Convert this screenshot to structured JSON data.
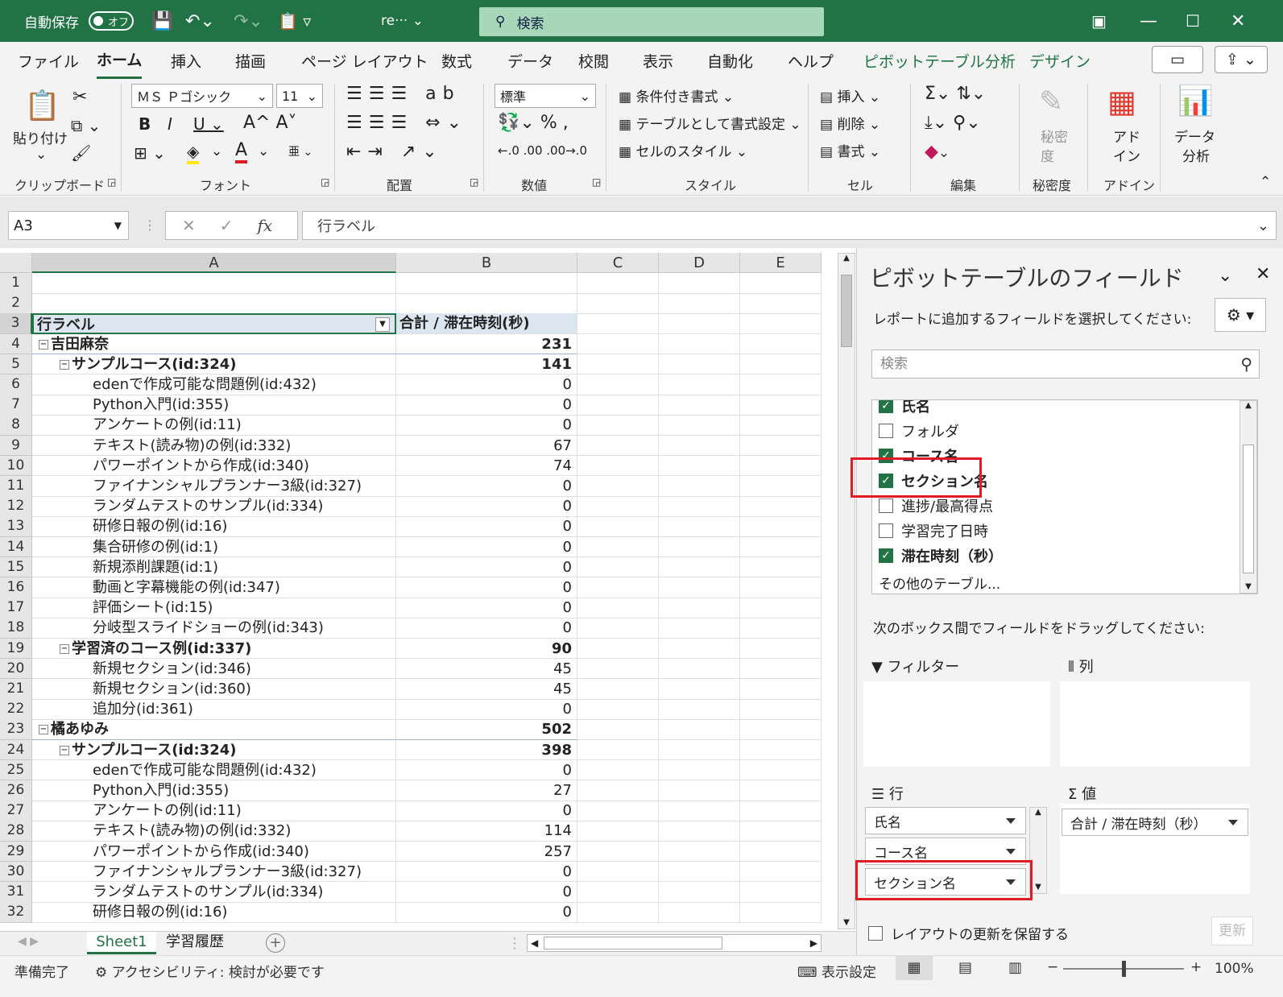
{
  "titlebar": {
    "autosave": "自動保存",
    "autosave_state": "オフ",
    "filename": "re···",
    "search_placeholder": "検索"
  },
  "menu": [
    "ファイル",
    "ホーム",
    "挿入",
    "描画",
    "ページ レイアウト",
    "数式",
    "データ",
    "校閲",
    "表示",
    "自動化",
    "ヘルプ",
    "ピボットテーブル分析",
    "デザイン"
  ],
  "ribbon": {
    "clipboard": {
      "paste": "貼り付け",
      "label": "クリップボード"
    },
    "font": {
      "name": "ＭＳ Ｐゴシック",
      "size": "11",
      "label": "フォント"
    },
    "align": {
      "label": "配置"
    },
    "number": {
      "format": "標準",
      "label": "数値"
    },
    "style": {
      "cond": "条件付き書式",
      "table": "テーブルとして書式設定",
      "cell": "セルのスタイル",
      "label": "スタイル"
    },
    "cells": {
      "insert": "挿入",
      "delete": "削除",
      "format": "書式",
      "label": "セル"
    },
    "edit": {
      "label": "編集"
    },
    "sens": {
      "btn1": "秘密",
      "btn2": "度",
      "label": "秘密度"
    },
    "addin": {
      "btn1": "アド",
      "btn2": "イン",
      "label": "アドイン"
    },
    "analyze": {
      "btn1": "データ",
      "btn2": "分析"
    }
  },
  "formula": {
    "namebox": "A3",
    "fx": "fx",
    "content": "行ラベル"
  },
  "columns": [
    "A",
    "B",
    "C",
    "D",
    "E"
  ],
  "rows": [
    {
      "n": "1",
      "a": "",
      "b": ""
    },
    {
      "n": "2",
      "a": "",
      "b": ""
    },
    {
      "n": "3",
      "a": "行ラベル",
      "b": "合計 / 滞在時刻(秒)"
    },
    {
      "n": "4",
      "a": "吉田麻奈",
      "b": "231"
    },
    {
      "n": "5",
      "a": "サンプルコース(id:324)",
      "b": "141"
    },
    {
      "n": "6",
      "a": "edenで作成可能な問題例(id:432)",
      "b": "0"
    },
    {
      "n": "7",
      "a": "Python入門(id:355)",
      "b": "0"
    },
    {
      "n": "8",
      "a": "アンケートの例(id:11)",
      "b": "0"
    },
    {
      "n": "9",
      "a": "テキスト(読み物)の例(id:332)",
      "b": "67"
    },
    {
      "n": "10",
      "a": "パワーポイントから作成(id:340)",
      "b": "74"
    },
    {
      "n": "11",
      "a": "ファイナンシャルプランナー3級(id:327)",
      "b": "0"
    },
    {
      "n": "12",
      "a": "ランダムテストのサンプル(id:334)",
      "b": "0"
    },
    {
      "n": "13",
      "a": "研修日報の例(id:16)",
      "b": "0"
    },
    {
      "n": "14",
      "a": "集合研修の例(id:1)",
      "b": "0"
    },
    {
      "n": "15",
      "a": "新規添削課題(id:1)",
      "b": "0"
    },
    {
      "n": "16",
      "a": "動画と字幕機能の例(id:347)",
      "b": "0"
    },
    {
      "n": "17",
      "a": "評価シート(id:15)",
      "b": "0"
    },
    {
      "n": "18",
      "a": "分岐型スライドショーの例(id:343)",
      "b": "0"
    },
    {
      "n": "19",
      "a": "学習済のコース例(id:337)",
      "b": "90"
    },
    {
      "n": "20",
      "a": "新規セクション(id:346)",
      "b": "45"
    },
    {
      "n": "21",
      "a": "新規セクション(id:360)",
      "b": "45"
    },
    {
      "n": "22",
      "a": "追加分(id:361)",
      "b": "0"
    },
    {
      "n": "23",
      "a": "橘あゆみ",
      "b": "502"
    },
    {
      "n": "24",
      "a": "サンプルコース(id:324)",
      "b": "398"
    },
    {
      "n": "25",
      "a": "edenで作成可能な問題例(id:432)",
      "b": "0"
    },
    {
      "n": "26",
      "a": "Python入門(id:355)",
      "b": "27"
    },
    {
      "n": "27",
      "a": "アンケートの例(id:11)",
      "b": "0"
    },
    {
      "n": "28",
      "a": "テキスト(読み物)の例(id:332)",
      "b": "114"
    },
    {
      "n": "29",
      "a": "パワーポイントから作成(id:340)",
      "b": "257"
    },
    {
      "n": "30",
      "a": "ファイナンシャルプランナー3級(id:327)",
      "b": "0"
    },
    {
      "n": "31",
      "a": "ランダムテストのサンプル(id:334)",
      "b": "0"
    },
    {
      "n": "32",
      "a": "研修日報の例(id:16)",
      "b": "0"
    }
  ],
  "sheets": [
    "Sheet1",
    "学習履歴"
  ],
  "status": {
    "ready": "準備完了",
    "access": "アクセシビリティ: 検討が必要です",
    "display": "表示設定",
    "zoom": "100%"
  },
  "pivot": {
    "title": "ピボットテーブルのフィールド",
    "subtitle": "レポートに追加するフィールドを選択してください:",
    "search": "検索",
    "fields": [
      {
        "label": "氏名",
        "checked": true
      },
      {
        "label": "フォルダ",
        "checked": false
      },
      {
        "label": "コース名",
        "checked": true
      },
      {
        "label": "セクション名",
        "checked": true
      },
      {
        "label": "進捗/最高得点",
        "checked": false
      },
      {
        "label": "学習完了日時",
        "checked": false
      },
      {
        "label": "滞在時刻（秒）",
        "checked": true
      }
    ],
    "more": "その他のテーブル...",
    "drag_hint": "次のボックス間でフィールドをドラッグしてください:",
    "filter": "フィルター",
    "columns": "列",
    "rows_label": "行",
    "values": "値",
    "row_items": [
      "氏名",
      "コース名",
      "セクション名"
    ],
    "value_items": [
      "合計 / 滞在時刻（秒）"
    ],
    "defer": "レイアウトの更新を保留する",
    "update": "更新"
  },
  "colors": {
    "excel_green": "#217346",
    "highlight_red": "#e01b24"
  }
}
